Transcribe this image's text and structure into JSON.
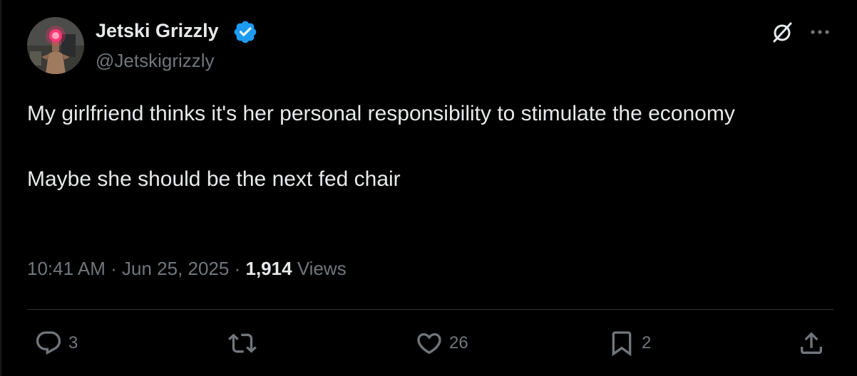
{
  "author": {
    "display_name": "Jetski Grizzly",
    "handle": "@Jetskigrizzly",
    "verified": true,
    "verified_color": "#1d9bf0"
  },
  "header_icons": {
    "grok": "grok-icon",
    "more": "more-icon"
  },
  "tweet": {
    "line1": "My girlfriend thinks it's her personal responsibility to stimulate the economy",
    "line2": "Maybe she should be the next fed chair"
  },
  "meta": {
    "time": "10:41 AM",
    "separator": "·",
    "date": "Jun 25, 2025",
    "views_count": "1,914",
    "views_label": "Views"
  },
  "actions": {
    "reply_count": "3",
    "retweet_count": "",
    "like_count": "26",
    "bookmark_count": "2"
  },
  "colors": {
    "background": "#000000",
    "text": "#e7e9ea",
    "secondary": "#71767b",
    "divider": "#2f3336"
  }
}
